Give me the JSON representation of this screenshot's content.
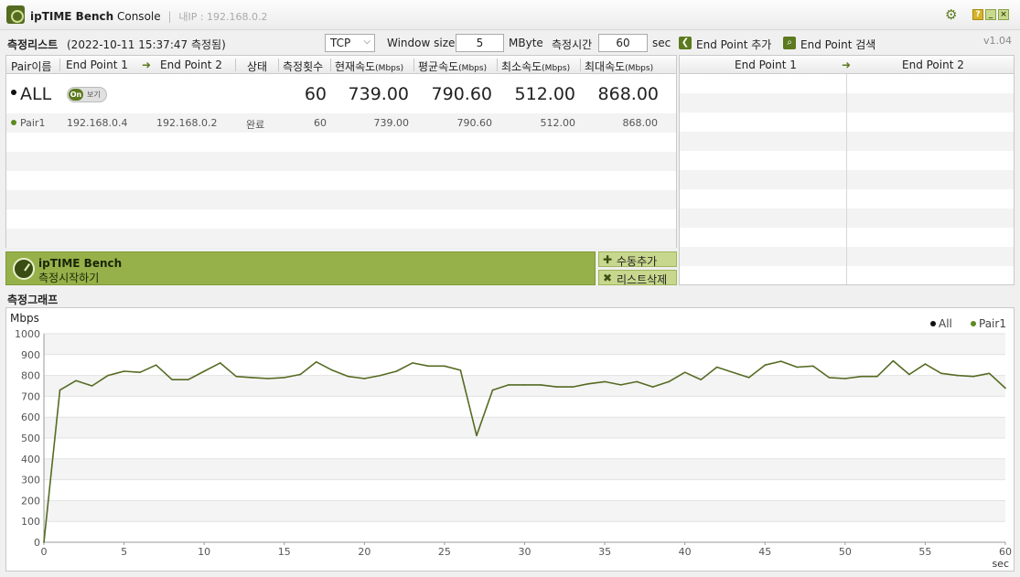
{
  "titlebar": {
    "app_name": "ipTIME Bench",
    "app_suffix": "Console",
    "separator": "|",
    "lan_ip": "내IP : 192.168.0.2",
    "help_label": "?",
    "minimize_label": "_",
    "close_label": "×"
  },
  "toolbar": {
    "title": "측정리스트",
    "date": "(2022-10-11 15:37:47 측정됨)",
    "protocol": "TCP",
    "window_size_label": "Window size",
    "window_size_value": "5",
    "window_size_unit": "MByte",
    "duration_label": "측정시간",
    "duration_value": "60",
    "duration_unit": "sec",
    "add_endpoint": "End Point 추가",
    "search_endpoint": "End Point 검색",
    "version": "v1.04"
  },
  "list": {
    "headers": {
      "pair": "Pair이름",
      "ep1": "End Point 1",
      "arrow": "➜",
      "ep2": "End Point 2",
      "status": "상태",
      "count": "측정횟수",
      "current": "현재속도",
      "average": "평균속도",
      "min": "최소속도",
      "max": "최대속도",
      "unit": "(Mbps)"
    },
    "all_row": {
      "name": "ALL",
      "toggle_on": "On",
      "toggle_label": "보기",
      "count": "60",
      "current": "739.00",
      "average": "790.60",
      "min": "512.00",
      "max": "868.00"
    },
    "pairs": [
      {
        "name": "Pair1",
        "ep1": "192.168.0.4",
        "ep2": "192.168.0.2",
        "status": "완료",
        "count": "60",
        "current": "739.00",
        "average": "790.60",
        "min": "512.00",
        "max": "868.00"
      }
    ]
  },
  "endpoints": {
    "ep1": "End Point 1",
    "arrow": "➜",
    "ep2": "End Point 2"
  },
  "start": {
    "title": "ipTIME Bench",
    "subtitle": "측정시작하기"
  },
  "side_buttons": {
    "manual_add": "수동추가",
    "delete_list": "리스트삭제"
  },
  "graph": {
    "title": "측정그래프"
  },
  "colors": {
    "accent": "#5c7a1e",
    "start_button": "#97b14a",
    "series_pair1": "#556b22"
  },
  "chart_data": {
    "type": "line",
    "ylabel": "Mbps",
    "xlabel": "sec",
    "ylim": [
      0,
      1000
    ],
    "xlim": [
      0,
      60
    ],
    "yticks": [
      0,
      100,
      200,
      300,
      400,
      500,
      600,
      700,
      800,
      900,
      1000
    ],
    "xticks": [
      0,
      5,
      10,
      15,
      20,
      25,
      30,
      35,
      40,
      45,
      50,
      55,
      60
    ],
    "grid": true,
    "legend_position": "top-right",
    "legend": [
      {
        "name": "All",
        "color": "#111111"
      },
      {
        "name": "Pair1",
        "color": "#5c8a1e"
      }
    ],
    "series": [
      {
        "name": "Pair1",
        "color": "#556b22",
        "x": [
          0,
          1,
          2,
          3,
          4,
          5,
          6,
          7,
          8,
          9,
          10,
          11,
          12,
          13,
          14,
          15,
          16,
          17,
          18,
          19,
          20,
          21,
          22,
          23,
          24,
          25,
          26,
          27,
          28,
          29,
          30,
          31,
          32,
          33,
          34,
          35,
          36,
          37,
          38,
          39,
          40,
          41,
          42,
          43,
          44,
          45,
          46,
          47,
          48,
          49,
          50,
          51,
          52,
          53,
          54,
          55,
          56,
          57,
          58,
          59,
          60
        ],
        "y": [
          0,
          730,
          775,
          750,
          800,
          820,
          815,
          850,
          780,
          780,
          820,
          860,
          795,
          790,
          785,
          790,
          805,
          865,
          825,
          795,
          785,
          800,
          820,
          860,
          845,
          845,
          825,
          512,
          730,
          755,
          755,
          755,
          745,
          745,
          760,
          770,
          755,
          770,
          745,
          770,
          815,
          780,
          840,
          815,
          790,
          850,
          868,
          840,
          845,
          790,
          785,
          795,
          795,
          870,
          805,
          855,
          810,
          800,
          795,
          810,
          739
        ]
      }
    ]
  }
}
